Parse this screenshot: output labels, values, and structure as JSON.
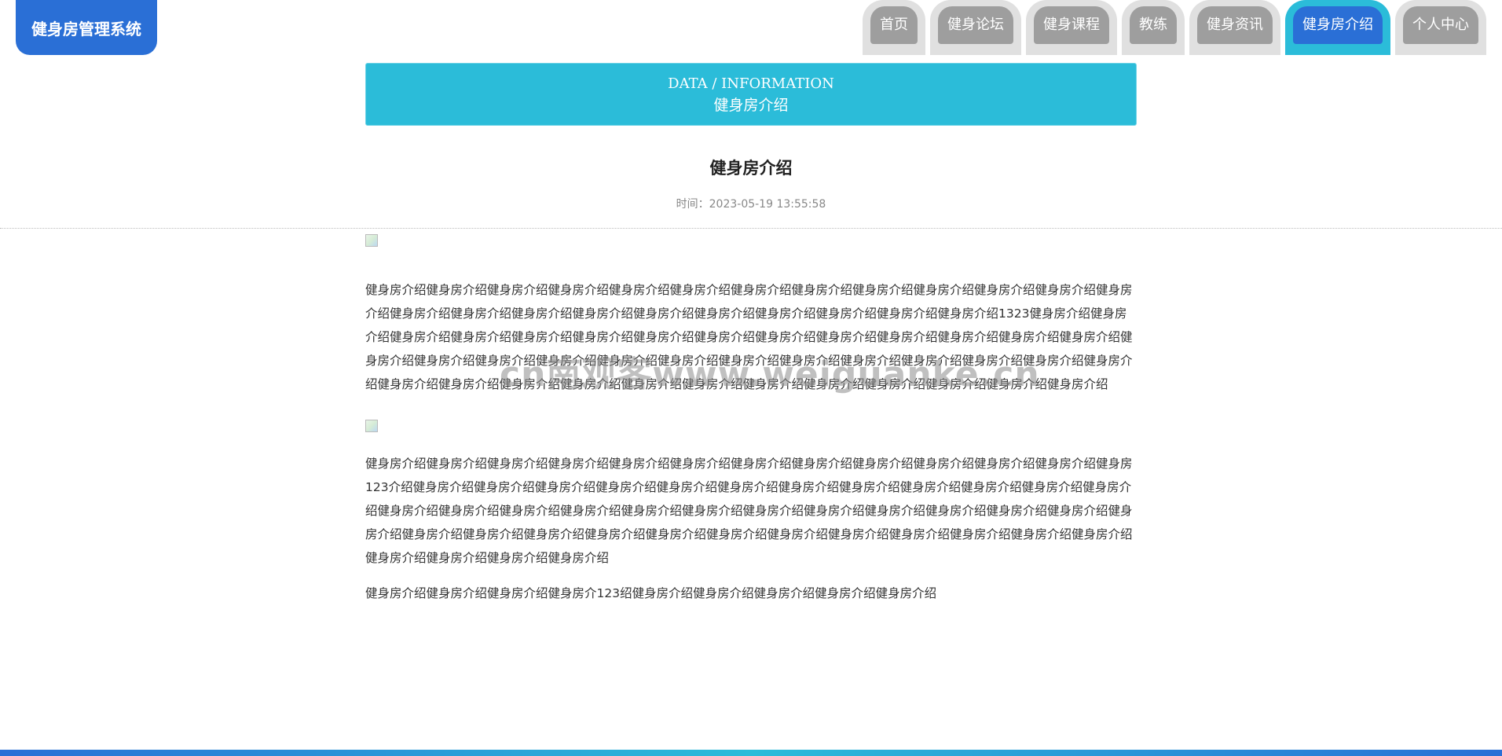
{
  "app": {
    "logo": "健身房管理系统"
  },
  "nav": {
    "items": [
      {
        "label": "首页",
        "active": false
      },
      {
        "label": "健身论坛",
        "active": false
      },
      {
        "label": "健身课程",
        "active": false
      },
      {
        "label": "教练",
        "active": false
      },
      {
        "label": "健身资讯",
        "active": false
      },
      {
        "label": "健身房介绍",
        "active": true
      },
      {
        "label": "个人中心",
        "active": false
      }
    ]
  },
  "banner": {
    "en": "DATA / INFORMATION",
    "cn": "健身房介绍"
  },
  "article": {
    "title": "健身房介绍",
    "time": "时间：2023-05-19 13:55:58",
    "para1": "健身房介绍健身房介绍健身房介绍健身房介绍健身房介绍健身房介绍健身房介绍健身房介绍健身房介绍健身房介绍健身房介绍健身房介绍健身房介绍健身房介绍健身房介绍健身房介绍健身房介绍健身房介绍健身房介绍健身房介绍健身房介绍健身房介绍健身房介绍1323健身房介绍健身房介绍健身房介绍健身房介绍健身房介绍健身房介绍健身房介绍健身房介绍健身房介绍健身房介绍健身房介绍健身房介绍健身房介绍健身房介绍健身房介绍健身房介绍健身房介绍健身房介绍健身房介绍健身房介绍健身房介绍健身房介绍健身房介绍健身房介绍健身房介绍健身房介绍健身房介绍健身房介绍健身房介绍健身房介绍健身房介绍健身房介绍健身房介绍健身房介绍健身房介绍健身房介绍健身房介绍健身房介绍健身房介绍",
    "para2": "健身房介绍健身房介绍健身房介绍健身房介绍健身房介绍健身房介绍健身房介绍健身房介绍健身房介绍健身房介绍健身房介绍健身房介绍健身房123介绍健身房介绍健身房介绍健身房介绍健身房介绍健身房介绍健身房介绍健身房介绍健身房介绍健身房介绍健身房介绍健身房介绍健身房介绍健身房介绍健身房介绍健身房介绍健身房介绍健身房介绍健身房介绍健身房介绍健身房介绍健身房介绍健身房介绍健身房介绍健身房介绍健身房介绍健身房介绍健身房介绍健身房介绍健身房介绍健身房介绍健身房介绍健身房介绍健身房介绍健身房介绍健身房介绍健身房介绍健身房介绍健身房介绍健身房介绍健身房介绍健身房介绍",
    "para3": "健身房介绍健身房介绍健身房介绍健身房介123绍健身房介绍健身房介绍健身房介绍健身房介绍健身房介绍"
  },
  "watermark": "cn南观客www.weiguanke.cn",
  "colors": {
    "primary": "#2a6fd6",
    "accent": "#2bbcd9",
    "tab_gray": "#9e9e9e"
  }
}
